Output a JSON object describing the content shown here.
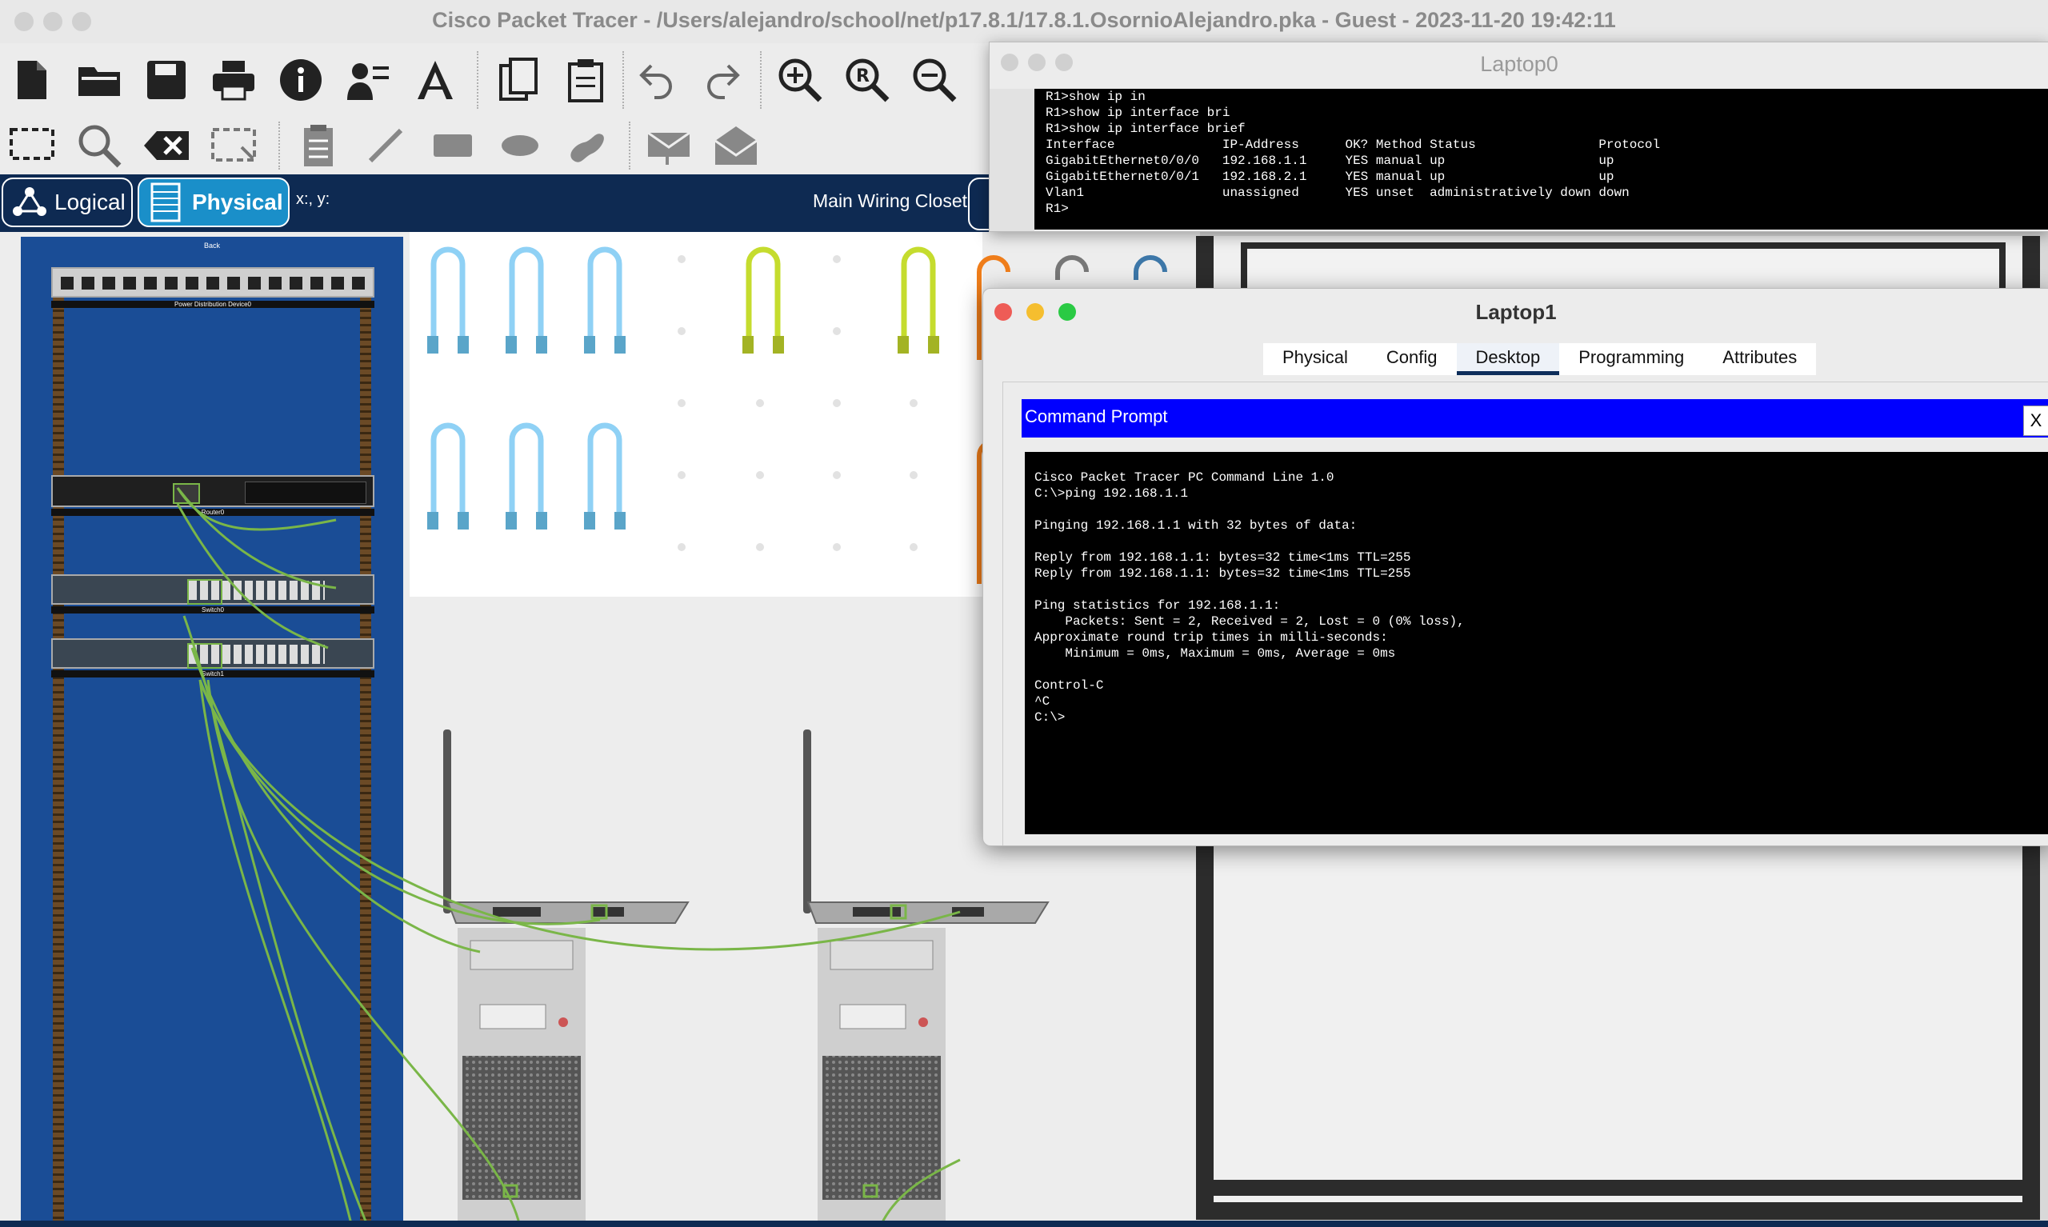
{
  "window": {
    "title": "Cisco Packet Tracer - /Users/alejandro/school/net/p17.8.1/17.8.1.OsornioAlejandro.pka - Guest - 2023-11-20 19:42:11"
  },
  "toolbar": {
    "row1_icons": [
      "new-file-icon",
      "open-folder-icon",
      "save-icon",
      "print-icon",
      "info-icon",
      "activity-wizard-icon",
      "custom-device-icon",
      "copy-icon",
      "paste-icon",
      "undo-icon",
      "redo-icon",
      "zoom-in-icon",
      "zoom-reset-icon",
      "zoom-out-icon"
    ],
    "row2_icons": [
      "select-icon",
      "inspect-icon",
      "delete-icon",
      "resize-icon",
      "note-icon",
      "draw-line-icon",
      "rectangle-icon",
      "ellipse-icon",
      "freeform-icon",
      "add-simple-pdu-icon",
      "add-complex-pdu-icon"
    ]
  },
  "modebar": {
    "logical_label": "Logical",
    "physical_label": "Physical",
    "coords_label": "x:, y:",
    "location_label": "Main Wiring Closet"
  },
  "rack": {
    "back_label": "Back",
    "pdu_label": "Power Distribution Device0",
    "router_label": "Router0",
    "switch0_label": "Switch0",
    "switch1_label": "Switch1"
  },
  "laptop0": {
    "title": "Laptop0",
    "terminal": "R1>show ip in\nR1>show ip interface bri\nR1>show ip interface brief\nInterface              IP-Address      OK? Method Status                Protocol\nGigabitEthernet0/0/0   192.168.1.1     YES manual up                    up\nGigabitEthernet0/0/1   192.168.2.1     YES manual up                    up\nVlan1                  unassigned      YES unset  administratively down down\nR1>"
  },
  "laptop1": {
    "title": "Laptop1",
    "tabs": [
      "Physical",
      "Config",
      "Desktop",
      "Programming",
      "Attributes"
    ],
    "active_tab": "Desktop",
    "command_prompt_title": "Command Prompt",
    "close_label": "X",
    "terminal": "Cisco Packet Tracer PC Command Line 1.0\nC:\\>ping 192.168.1.1\n\nPinging 192.168.1.1 with 32 bytes of data:\n\nReply from 192.168.1.1: bytes=32 time<1ms TTL=255\nReply from 192.168.1.1: bytes=32 time<1ms TTL=255\n\nPing statistics for 192.168.1.1:\n    Packets: Sent = 2, Received = 2, Lost = 0 (0% loss),\nApproximate round trip times in milli-seconds:\n    Minimum = 0ms, Maximum = 0ms, Average = 0ms\n\nControl-C\n^C\nC:\\>"
  },
  "colors": {
    "modebar_bg": "#0e2a52",
    "physical_active": "#1a8fc9",
    "rack_blue": "#1a4d96",
    "cable_green": "#7ab648",
    "cable_light_blue": "#8fd1f5",
    "cable_yellow_green": "#c5dc2e",
    "cable_orange": "#ef7d1a"
  }
}
